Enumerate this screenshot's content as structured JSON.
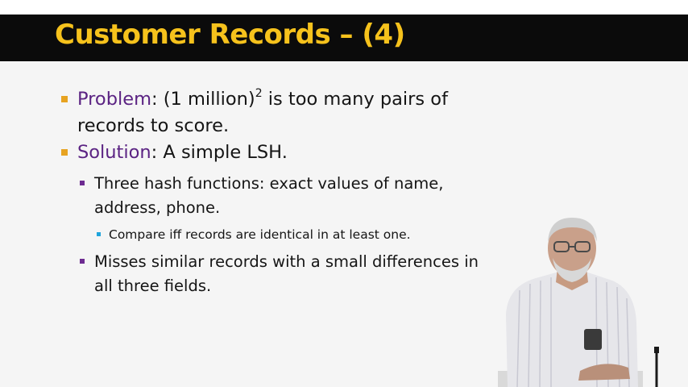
{
  "slide": {
    "title": "Customer Records – (4)",
    "bullets": [
      {
        "keyword": "Problem",
        "text_before_sup": ": (1 million)",
        "sup": "2",
        "text_after_sup": " is too many pairs of records to score."
      },
      {
        "keyword": "Solution",
        "text": ": A simple LSH."
      }
    ],
    "sub_bullets": [
      {
        "text": "Three hash functions: exact values of name, address, phone."
      },
      {
        "text": "Misses similar records with a small differences in all three fields."
      }
    ],
    "sub_sub_bullets": [
      {
        "text": "Compare iff records are identical in at least one."
      }
    ]
  },
  "colors": {
    "title": "#f6c21c",
    "title_bar": "#0b0b0b",
    "keyword": "#5b2383",
    "bullet_l1": "#e7a321",
    "bullet_l2": "#6d2b91",
    "bullet_l3": "#1ea4dc"
  }
}
